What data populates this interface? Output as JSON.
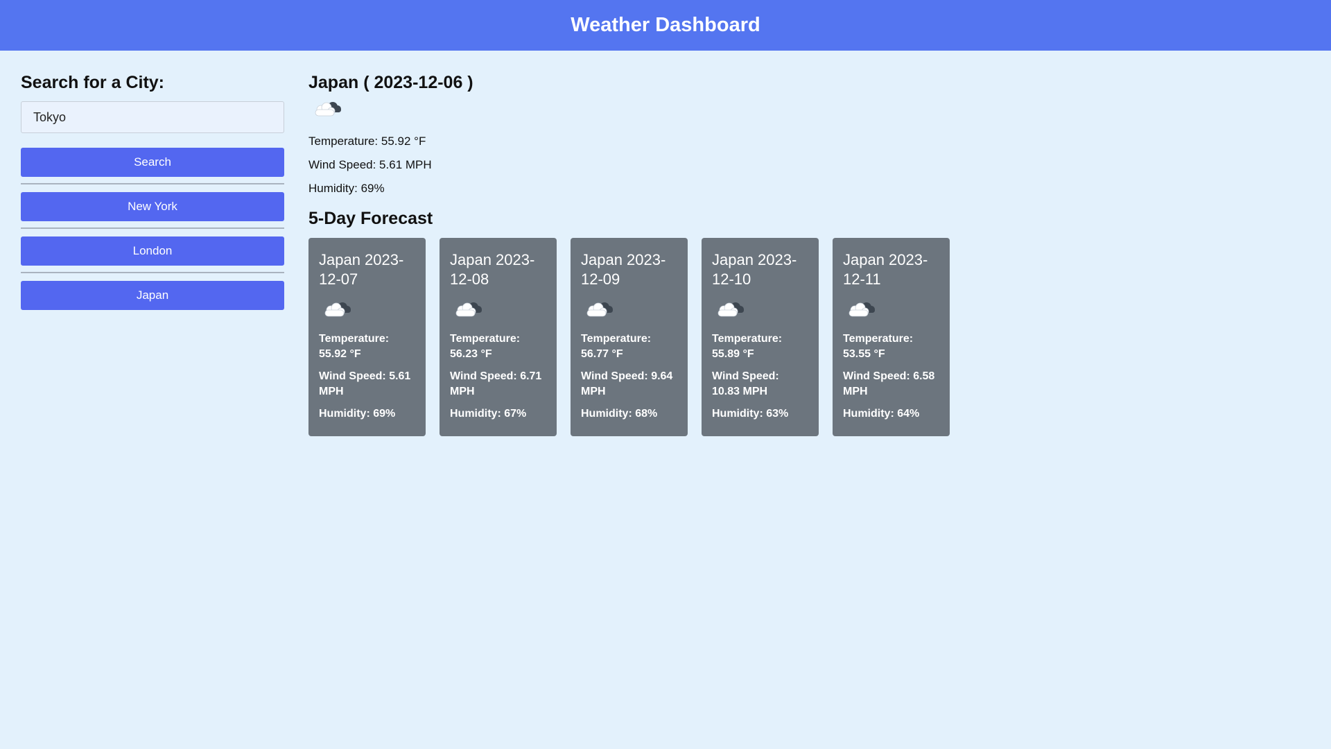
{
  "header": {
    "title": "Weather Dashboard"
  },
  "sidebar": {
    "heading": "Search for a City:",
    "search_value": "Tokyo",
    "search_button": "Search",
    "history": [
      "New York",
      "London",
      "Japan"
    ]
  },
  "current": {
    "title": "Japan ( 2023-12-06 )",
    "icon": "cloud-icon",
    "temperature": "Temperature: 55.92 °F",
    "wind": "Wind Speed: 5.61 MPH",
    "humidity": "Humidity: 69%"
  },
  "forecast": {
    "heading": "5-Day Forecast",
    "days": [
      {
        "title": "Japan 2023-12-07",
        "icon": "cloud-icon",
        "temperature": "Temperature: 55.92 °F",
        "wind": "Wind Speed: 5.61 MPH",
        "humidity": "Humidity: 69%"
      },
      {
        "title": "Japan 2023-12-08",
        "icon": "cloud-icon",
        "temperature": "Temperature: 56.23 °F",
        "wind": "Wind Speed: 6.71 MPH",
        "humidity": "Humidity: 67%"
      },
      {
        "title": "Japan 2023-12-09",
        "icon": "cloud-icon",
        "temperature": "Temperature: 56.77 °F",
        "wind": "Wind Speed: 9.64 MPH",
        "humidity": "Humidity: 68%"
      },
      {
        "title": "Japan 2023-12-10",
        "icon": "cloud-icon",
        "temperature": "Temperature: 55.89 °F",
        "wind": "Wind Speed: 10.83 MPH",
        "humidity": "Humidity: 63%"
      },
      {
        "title": "Japan 2023-12-11",
        "icon": "cloud-icon",
        "temperature": "Temperature: 53.55 °F",
        "wind": "Wind Speed: 6.58 MPH",
        "humidity": "Humidity: 64%"
      }
    ]
  },
  "colors": {
    "header_bg": "#5475f0",
    "page_bg": "#e3f1fc",
    "button_bg": "#5367f0",
    "card_bg": "#6c757e"
  }
}
